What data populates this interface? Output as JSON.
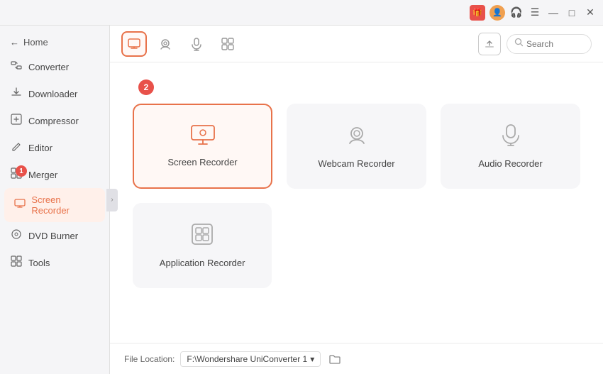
{
  "titlebar": {
    "icons": {
      "gift": "🎁",
      "avatar": "👤",
      "headset": "🎧",
      "menu": "☰",
      "minimize": "—",
      "maximize": "□",
      "close": "✕"
    }
  },
  "sidebar": {
    "home_label": "Home",
    "items": [
      {
        "id": "converter",
        "label": "Converter",
        "icon": "⇄",
        "badge": null
      },
      {
        "id": "downloader",
        "label": "Downloader",
        "icon": "↓",
        "badge": null
      },
      {
        "id": "compressor",
        "label": "Compressor",
        "icon": "⊡",
        "badge": null
      },
      {
        "id": "editor",
        "label": "Editor",
        "icon": "✂",
        "badge": null
      },
      {
        "id": "merger",
        "label": "Merger",
        "icon": "⊞",
        "badge": 1
      },
      {
        "id": "screen-recorder",
        "label": "Screen Recorder",
        "icon": "⊡",
        "badge": null,
        "active": true
      },
      {
        "id": "dvd-burner",
        "label": "DVD Burner",
        "icon": "⊙",
        "badge": null
      },
      {
        "id": "tools",
        "label": "Tools",
        "icon": "⊞",
        "badge": null
      }
    ]
  },
  "toolbar": {
    "buttons": [
      {
        "id": "screen",
        "icon": "🖥",
        "active": true
      },
      {
        "id": "webcam",
        "icon": "📷",
        "active": false
      },
      {
        "id": "audio",
        "icon": "🎙",
        "active": false
      },
      {
        "id": "apps",
        "icon": "⊞",
        "active": false
      }
    ],
    "search_placeholder": "Search"
  },
  "badge_2": "2",
  "cards": {
    "rows": [
      [
        {
          "id": "screen-recorder",
          "label": "Screen Recorder",
          "icon": "screen",
          "selected": true
        },
        {
          "id": "webcam-recorder",
          "label": "Webcam Recorder",
          "icon": "webcam",
          "selected": false
        },
        {
          "id": "audio-recorder",
          "label": "Audio Recorder",
          "icon": "audio",
          "selected": false
        }
      ],
      [
        {
          "id": "application-recorder",
          "label": "Application Recorder",
          "icon": "app",
          "selected": false
        }
      ]
    ]
  },
  "bottom_bar": {
    "label": "File Location:",
    "path": "F:\\Wondershare UniConverter 1",
    "path_arrow": "▾"
  }
}
